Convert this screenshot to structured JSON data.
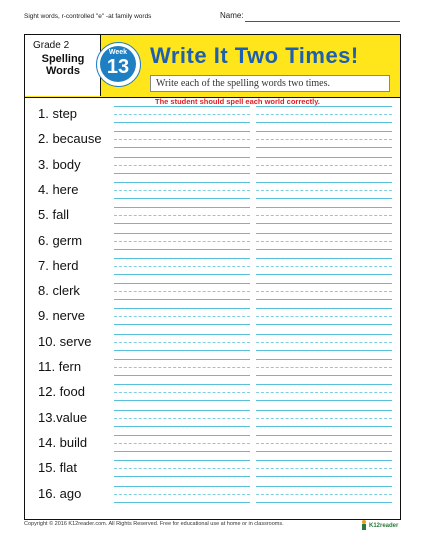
{
  "top_note": "Sight words, r-controlled \"e\" -at family words",
  "name_label": "Name:",
  "header": {
    "grade": "Grade 2",
    "spelling_words": "Spelling Words",
    "week_label": "Week",
    "week_number": "13",
    "title": "Write It Two Times!",
    "instruction": "Write each of the spelling words two times."
  },
  "teacher_note": "The student should spell each world correctly.",
  "words": [
    "1. step",
    "2. because",
    "3. body",
    "4. here",
    "5. fall",
    "6. germ",
    "7. herd",
    "8. clerk",
    "9. nerve",
    "10. serve",
    "11. fern",
    "12. food",
    "13.value",
    "14. build",
    "15. flat",
    "16. ago"
  ],
  "footer": "Copyright © 2016 K12reader.com. All Rights Reserved. Free for educational use at home or in classrooms.",
  "logo_text": "K12reader",
  "colors": {
    "banner": "#ffe61a",
    "title": "#1e5fb0",
    "badge": "#1e7fc2",
    "line": "#59c0d9",
    "note": "#e02020"
  }
}
